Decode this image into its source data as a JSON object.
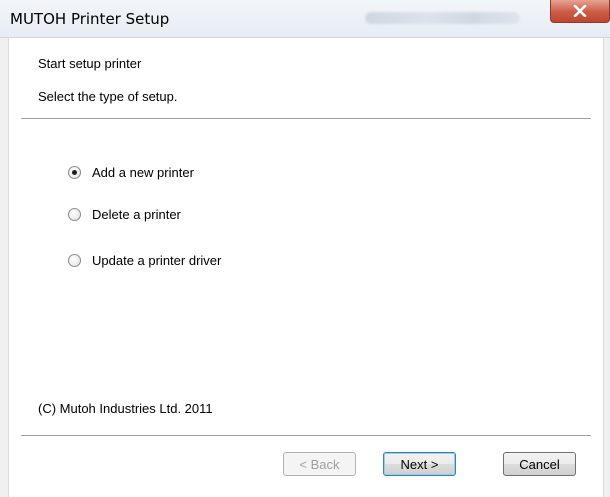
{
  "window": {
    "title": "MUTOH Printer Setup",
    "close_glyph": "X"
  },
  "header": {
    "line1": "Start setup printer",
    "line2": "Select the type of setup."
  },
  "options": [
    {
      "label": "Add a new printer",
      "checked": true
    },
    {
      "label": "Delete a printer",
      "checked": false
    },
    {
      "label": "Update a printer driver",
      "checked": false
    }
  ],
  "footer": {
    "copyright": "(C) Mutoh Industries Ltd. 2011"
  },
  "buttons": {
    "back": "< Back",
    "next": "Next >",
    "cancel": "Cancel"
  },
  "colors": {
    "close_button": "#c8553d",
    "content_bg": "#ffffff",
    "dialog_bg": "#f0f0f0"
  }
}
